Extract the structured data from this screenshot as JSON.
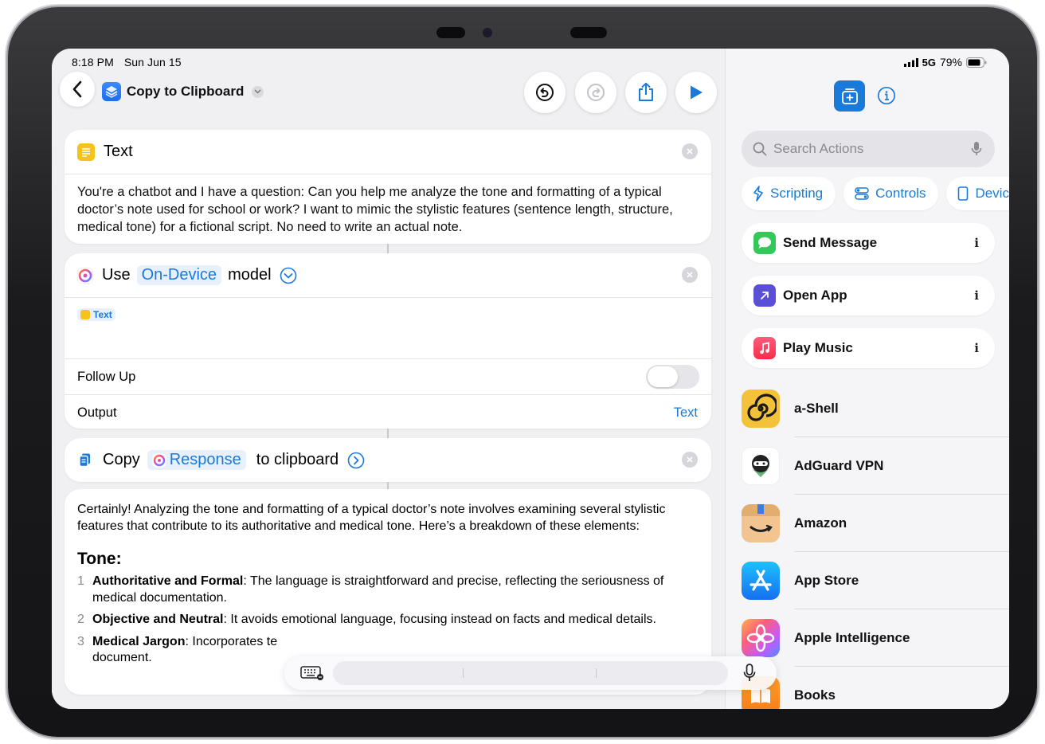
{
  "status": {
    "time": "8:18 PM",
    "date": "Sun Jun 15",
    "network": "5G",
    "battery": "79%"
  },
  "header": {
    "title": "Copy to Clipboard"
  },
  "text_action": {
    "label": "Text",
    "content": "You're a chatbot and I have a question: Can you help me analyze the tone and formatting of a typical doctor’s note used for school or work? I want to mimic the stylistic features (sentence length, structure, medical tone) for a fictional script. No need to write an actual note."
  },
  "model_action": {
    "use_label": "Use",
    "model_name": "On-Device",
    "model_label": "model",
    "input_token": "Text",
    "follow_up_label": "Follow Up",
    "follow_up_on": false,
    "output_label": "Output",
    "output_value": "Text"
  },
  "copy_action": {
    "copy_label": "Copy",
    "variable": "Response",
    "suffix": "to clipboard"
  },
  "response": {
    "intro": "Certainly! Analyzing the tone and formatting of a typical doctor’s note involves examining several stylistic features that contribute to its authoritative and medical tone. Here’s a breakdown of these elements:",
    "heading": "Tone:",
    "items": [
      {
        "num": "1",
        "bold": "Authoritative and Formal",
        "text": ": The language is straightforward and precise, reflecting the seriousness of medical documentation."
      },
      {
        "num": "2",
        "bold": "Objective and Neutral",
        "text": ": It avoids emotional language, focusing instead on facts and medical details."
      },
      {
        "num": "3",
        "bold": "Medical Jargon",
        "text": ": Incorporates te",
        "tail": "document."
      }
    ]
  },
  "panel": {
    "search_placeholder": "Search Actions",
    "chips": [
      "Scripting",
      "Controls",
      "Device"
    ],
    "actions": [
      "Send Message",
      "Open App",
      "Play Music"
    ],
    "info_glyph": "i",
    "apps": [
      "a-Shell",
      "AdGuard VPN",
      "Amazon",
      "App Store",
      "Apple Intelligence",
      "Books"
    ]
  },
  "colors": {
    "accent": "#1a7ad9",
    "text_yellow": "#f7c21a",
    "messages_green": "#34c759",
    "open_app_purple": "#5a4fd6",
    "music_red": "#fa2d48"
  }
}
